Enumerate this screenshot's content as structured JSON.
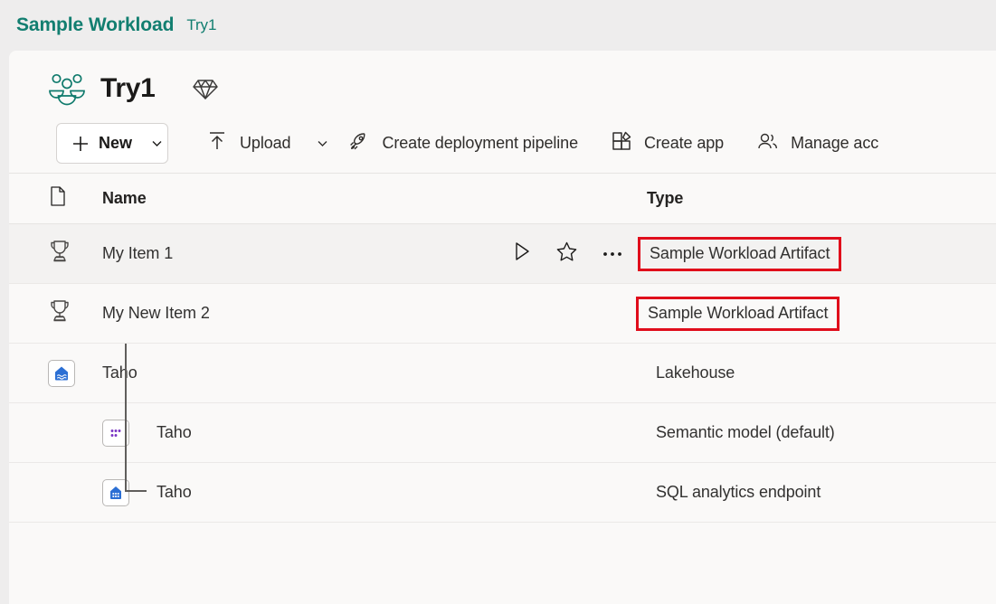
{
  "breadcrumb": {
    "primary": "Sample Workload",
    "secondary": "Try1",
    "accent_color": "#127e70"
  },
  "workspace": {
    "title": "Try1",
    "icon": "workspace-people-icon",
    "badge_icon": "diamond-gem-icon"
  },
  "commandbar": {
    "new_label": "New",
    "new_icon": "plus-icon",
    "new_chevron": "chevron-down-icon",
    "upload_label": "Upload",
    "upload_icon": "upload-arrow-icon",
    "upload_chevron": "chevron-down-icon",
    "pipeline_label": "Create deployment pipeline",
    "pipeline_icon": "rocket-icon",
    "app_label": "Create app",
    "app_icon": "create-app-icon",
    "access_label": "Manage acc",
    "access_icon": "people-icon"
  },
  "table": {
    "headers": {
      "icon": "file-type-icon",
      "name": "Name",
      "type": "Type"
    },
    "rows": [
      {
        "name": "My Item 1",
        "type": "Sample Workload Artifact",
        "icon": "trophy-icon",
        "type_highlighted": true,
        "selected": true,
        "indent": 0,
        "actions": [
          "run-icon",
          "favorite-star-icon",
          "more-options-icon"
        ]
      },
      {
        "name": "My New Item 2",
        "type": "Sample Workload Artifact",
        "icon": "trophy-icon",
        "type_highlighted": true,
        "selected": false,
        "indent": 0,
        "actions": []
      },
      {
        "name": "Taho",
        "type": "Lakehouse",
        "icon": "lakehouse-icon",
        "type_highlighted": false,
        "selected": false,
        "indent": 0,
        "actions": []
      },
      {
        "name": "Taho",
        "type": "Semantic model (default)",
        "icon": "semantic-model-icon",
        "type_highlighted": false,
        "selected": false,
        "indent": 1,
        "actions": []
      },
      {
        "name": "Taho",
        "type": "SQL analytics endpoint",
        "icon": "sql-endpoint-icon",
        "type_highlighted": false,
        "selected": false,
        "indent": 1,
        "actions": []
      }
    ]
  },
  "annotation": {
    "color": "#e00d1b"
  }
}
